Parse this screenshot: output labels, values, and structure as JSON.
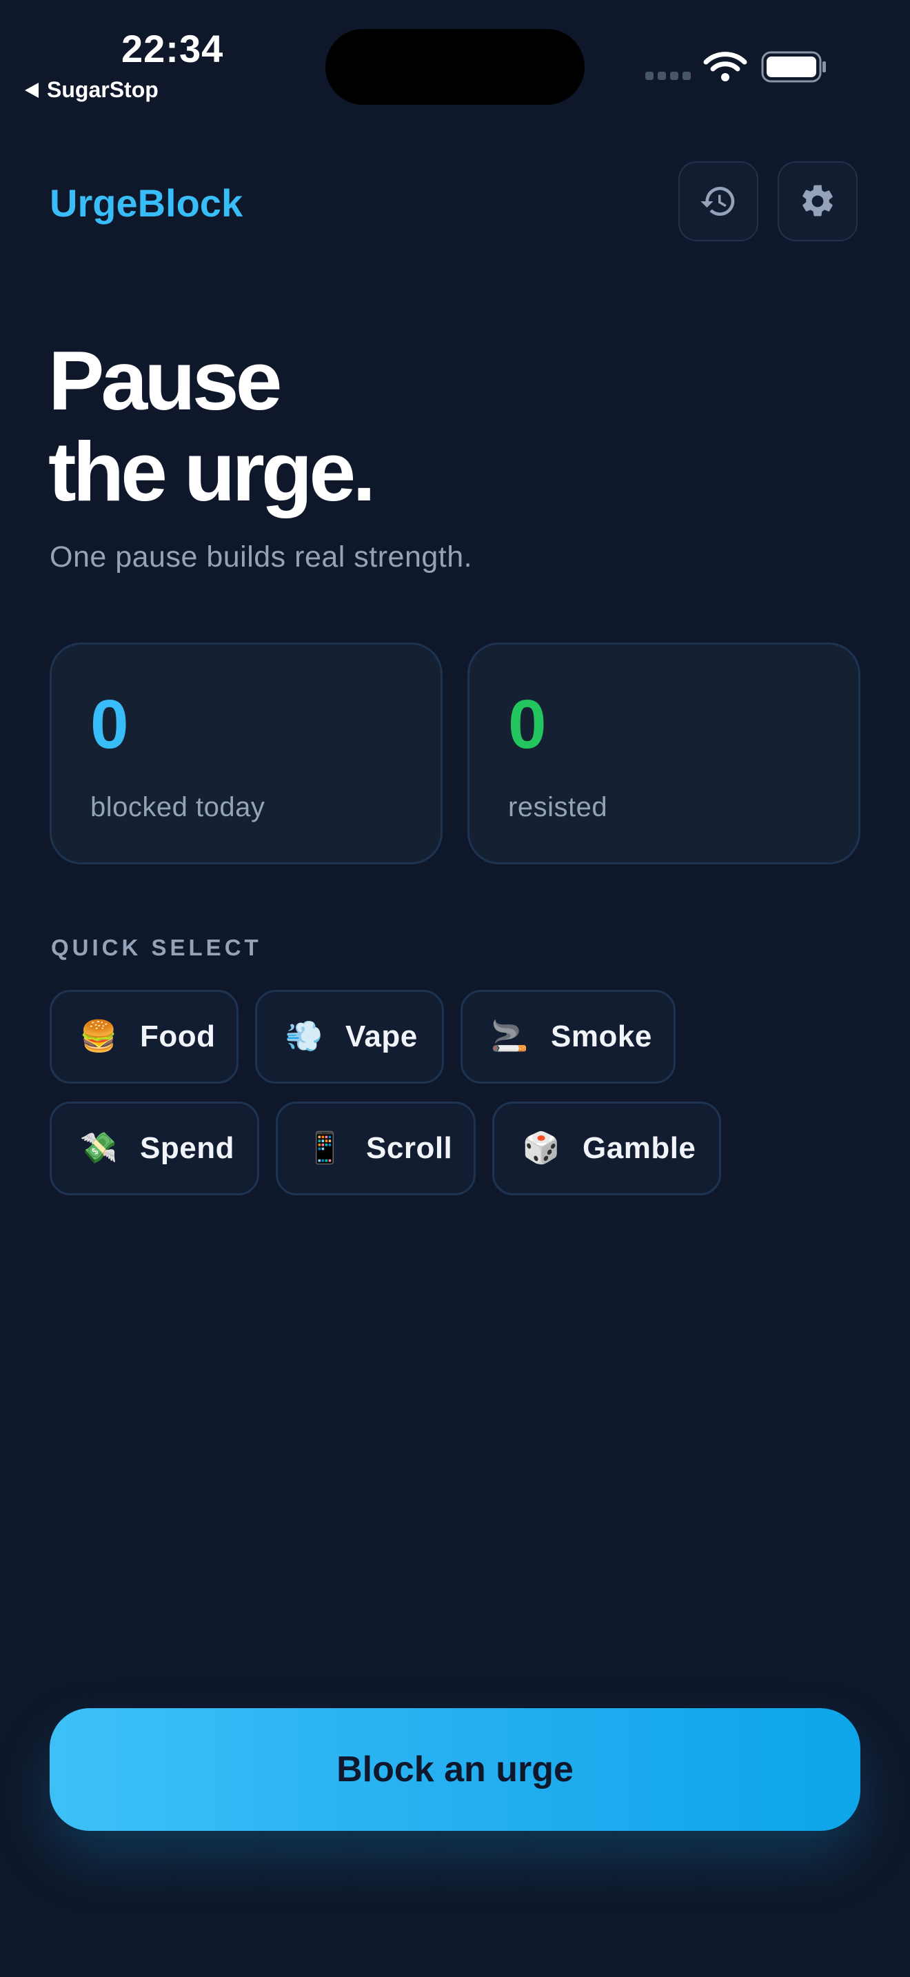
{
  "status_bar": {
    "time": "22:34",
    "back_app": "SugarStop"
  },
  "header": {
    "title": "UrgeBlock",
    "history_icon": "history-icon",
    "settings_icon": "gear-icon"
  },
  "hero": {
    "title_line1": "Pause",
    "title_line2": "the urge.",
    "subtitle": "One pause builds real strength."
  },
  "stats": [
    {
      "value": "0",
      "label": "blocked today",
      "color": "#38bdf8"
    },
    {
      "value": "0",
      "label": "resisted",
      "color": "#22c55e"
    }
  ],
  "quick_select": {
    "label": "QUICK SELECT",
    "items": [
      {
        "emoji": "🍔",
        "label": "Food"
      },
      {
        "emoji": "💨",
        "label": "Vape"
      },
      {
        "emoji": "🚬",
        "label": "Smoke"
      },
      {
        "emoji": "💸",
        "label": "Spend"
      },
      {
        "emoji": "📱",
        "label": "Scroll"
      },
      {
        "emoji": "🎲",
        "label": "Gamble"
      }
    ]
  },
  "cta": {
    "label": "Block an urge"
  },
  "colors": {
    "background": "#0f172a",
    "accent": "#38bdf8",
    "success": "#22c55e",
    "muted_text": "#94a3b8"
  }
}
